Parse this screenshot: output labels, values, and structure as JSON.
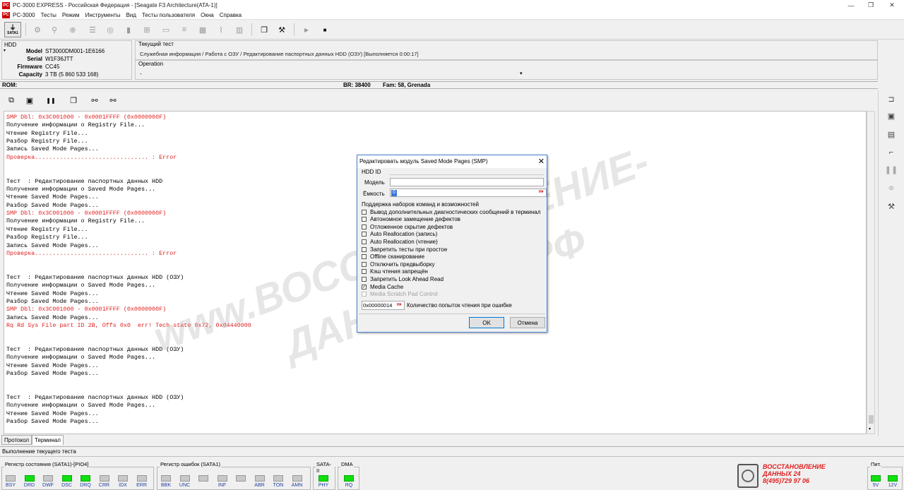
{
  "window": {
    "app_icon": "PC",
    "title": "PC-3000 EXPRESS - Российская Федерация - [Seagate F3 Architecture(ATA-1)]"
  },
  "menu": [
    "PC-3000",
    "Тесты",
    "Режим",
    "Инструменты",
    "Вид",
    "Тесты пользователя",
    "Окна",
    "Справка"
  ],
  "toolbar": {
    "sata_label": "SATA1"
  },
  "hdd": {
    "header": "HDD",
    "model_label": "Model",
    "model": "ST3000DM001-1E6166",
    "serial_label": "Serial",
    "serial": "W1F36JTT",
    "firmware_label": "Firmware",
    "firmware": "CC45",
    "capacity_label": "Capacity",
    "capacity": "3 TB (5 860 533 168)"
  },
  "current_test": {
    "label": "Текущий тест",
    "value": "Служебная информация / Работа с ОЗУ / Редактирование паспортных данных HDD (ОЗУ) [Выполняется 0:00:17]"
  },
  "operation": {
    "label": "Operation",
    "value": "-"
  },
  "rom": {
    "label": "ROM:",
    "br": "BR: 38400",
    "fam": "Fam: 58, Grenada"
  },
  "log": [
    {
      "t": "SMP Dbl: 0x3C001000 - 0x0001FFFF (0x0000000F)",
      "c": "red"
    },
    {
      "t": "Получение информации о Registry File...",
      "c": "black"
    },
    {
      "t": "Чтение Registry File...",
      "c": "black"
    },
    {
      "t": "Разбор Registry File...",
      "c": "black"
    },
    {
      "t": "Запись Saved Mode Pages...",
      "c": "black"
    },
    {
      "t": "Проверка................................ : Error",
      "c": "red"
    },
    {
      "t": "",
      "c": "black"
    },
    {
      "t": "",
      "c": "black"
    },
    {
      "t": "Тест  : Редактирование паспортных данных HDD",
      "c": "black"
    },
    {
      "t": "Получение информации о Saved Mode Pages...",
      "c": "black"
    },
    {
      "t": "Чтение Saved Mode Pages...",
      "c": "black"
    },
    {
      "t": "Разбор Saved Mode Pages...",
      "c": "black"
    },
    {
      "t": "SMP Dbl: 0x3C001000 - 0x0001FFFF (0x0000000F)",
      "c": "red"
    },
    {
      "t": "Получение информации о Registry File...",
      "c": "black"
    },
    {
      "t": "Чтение Registry File...",
      "c": "black"
    },
    {
      "t": "Разбор Registry File...",
      "c": "black"
    },
    {
      "t": "Запись Saved Mode Pages...",
      "c": "black"
    },
    {
      "t": "Проверка................................ : Error",
      "c": "red"
    },
    {
      "t": "",
      "c": "black"
    },
    {
      "t": "",
      "c": "black"
    },
    {
      "t": "Тест  : Редактирование паспортных данных HDD (ОЗУ)",
      "c": "black"
    },
    {
      "t": "Получение информации о Saved Mode Pages...",
      "c": "black"
    },
    {
      "t": "Чтение Saved Mode Pages...",
      "c": "black"
    },
    {
      "t": "Разбор Saved Mode Pages...",
      "c": "black"
    },
    {
      "t": "SMP Dbl: 0x3C001000 - 0x0001FFFF (0x0000000F)",
      "c": "red"
    },
    {
      "t": "Запись Saved Mode Pages...",
      "c": "black"
    },
    {
      "t": "Rq Rd Sys File part ID 2B, Offs 0x0  err! Tech state 0x72, 0x04440000",
      "c": "red"
    },
    {
      "t": "",
      "c": "black"
    },
    {
      "t": "",
      "c": "black"
    },
    {
      "t": "Тест  : Редактирование паспортных данных HDD (ОЗУ)",
      "c": "black"
    },
    {
      "t": "Получение информации о Saved Mode Pages...",
      "c": "black"
    },
    {
      "t": "Чтение Saved Mode Pages...",
      "c": "black"
    },
    {
      "t": "Разбор Saved Mode Pages...",
      "c": "black"
    },
    {
      "t": "",
      "c": "black"
    },
    {
      "t": "",
      "c": "black"
    },
    {
      "t": "Тест  : Редактирование паспортных данных HDD (ОЗУ)",
      "c": "black"
    },
    {
      "t": "Получение информации о Saved Mode Pages...",
      "c": "black"
    },
    {
      "t": "Чтение Saved Mode Pages...",
      "c": "black"
    },
    {
      "t": "Разбор Saved Mode Pages...",
      "c": "black"
    }
  ],
  "tabs": [
    "Протокол",
    "Терминал"
  ],
  "status_text": "Выполнение текущего теста",
  "status_register": {
    "title": "Регистр состояния (SATA1)-[PIO4]",
    "leds": [
      {
        "l": "BSY",
        "on": false
      },
      {
        "l": "DRD",
        "on": true
      },
      {
        "l": "DWF",
        "on": false
      },
      {
        "l": "DSC",
        "on": true
      },
      {
        "l": "DRQ",
        "on": true
      },
      {
        "l": "CRR",
        "on": false
      },
      {
        "l": "IDX",
        "on": false
      },
      {
        "l": "ERR",
        "on": false
      }
    ]
  },
  "error_register": {
    "title": "Регистр ошибок (SATA1)",
    "leds": [
      {
        "l": "BBK",
        "on": false
      },
      {
        "l": "UNC",
        "on": false
      },
      {
        "l": "",
        "on": false
      },
      {
        "l": "INF",
        "on": false
      },
      {
        "l": "",
        "on": false
      },
      {
        "l": "ABR",
        "on": false
      },
      {
        "l": "TON",
        "on": false
      },
      {
        "l": "AMN",
        "on": false
      }
    ]
  },
  "sata2": {
    "title": "SATA-II",
    "led": "PHY"
  },
  "dma": {
    "title": "DMA",
    "led": "RQ"
  },
  "power": {
    "title": "Пит.",
    "l1": "5V",
    "l2": "12V"
  },
  "logo": {
    "line1": "ВОССТАНОВЛЕНИЕ",
    "line2": "ДАННЫХ  24",
    "line3": "8(495)729 97 06"
  },
  "watermark": {
    "line1": "www.ВОССТАНОВЛЕНИЕ-",
    "line2": "ДАННЫХ-24.РФ"
  },
  "dialog": {
    "title": "Редактировать модуль Saved Mode Pages (SMP)",
    "hdd_id_label": "HDD ID",
    "model_label": "Модель",
    "capacity_label": "Ёмкость",
    "capacity_value": "0",
    "hex_btn": "H#",
    "features_label": "Поддержка наборов команд и возможностей",
    "checkboxes": [
      {
        "label": "Вывод дополнительных диагностических сообщений в терминал",
        "checked": false,
        "disabled": false
      },
      {
        "label": "Автономное замещение дефектов",
        "checked": false,
        "disabled": false
      },
      {
        "label": "Отложенное скрытие дефектов",
        "checked": false,
        "disabled": false
      },
      {
        "label": "Auto Reallocation (запись)",
        "checked": false,
        "disabled": false
      },
      {
        "label": "Auto Reallocation (чтение)",
        "checked": false,
        "disabled": false
      },
      {
        "label": "Запретить тесты при простое",
        "checked": false,
        "disabled": false
      },
      {
        "label": "Offline сканирование",
        "checked": false,
        "disabled": false
      },
      {
        "label": "Отключить предвыборку",
        "checked": false,
        "disabled": false
      },
      {
        "label": "Кэш чтения запрещён",
        "checked": false,
        "disabled": false
      },
      {
        "label": "Запретить Look Ahead Read",
        "checked": false,
        "disabled": false
      },
      {
        "label": "Media Cache",
        "checked": true,
        "disabled": false
      },
      {
        "label": "Media Scratch Pad Control",
        "checked": false,
        "disabled": true
      }
    ],
    "retries_value": "0x00000014",
    "retries_label": "Количество попыток чтения при ошибке",
    "ok": "OK",
    "cancel": "Отмена"
  }
}
